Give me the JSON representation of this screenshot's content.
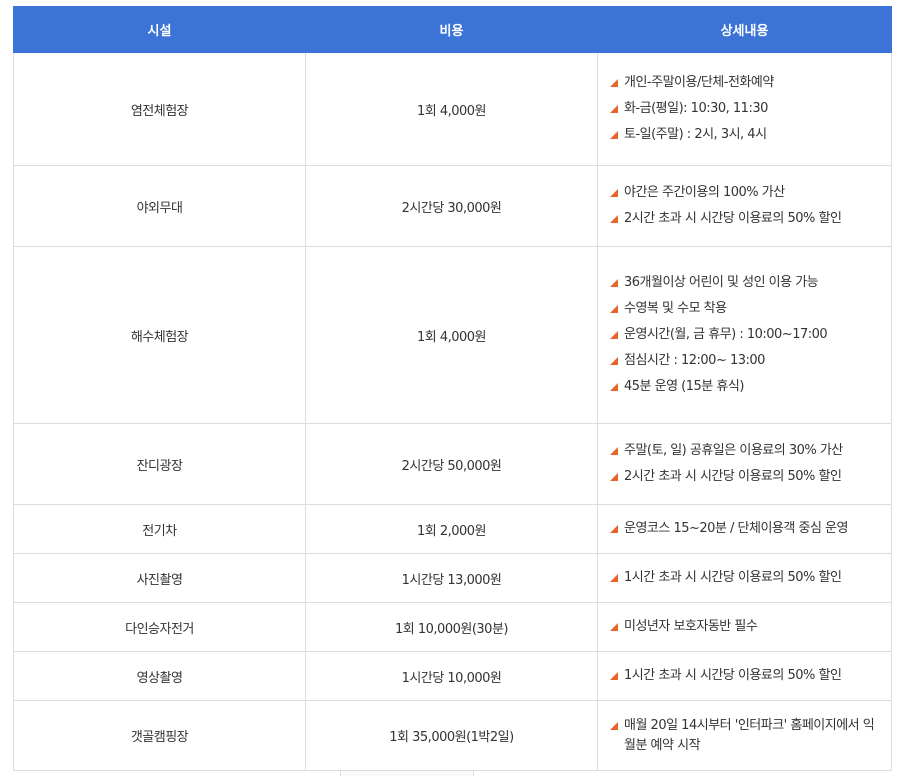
{
  "headers": [
    "시설",
    "비용",
    "상세내용"
  ],
  "rows": [
    {
      "facility": "염전체험장",
      "cost": "1회 4,000원",
      "details": [
        "개인-주말이용/단체-전화예약",
        "화-금(평일): 10:30, 11:30",
        "토-일(주말) : 2시, 3시, 4시"
      ]
    },
    {
      "facility": "야외무대",
      "cost": "2시간당 30,000원",
      "details": [
        "야간은 주간이용의 100% 가산",
        "2시간 초과 시 시간당 이용료의 50% 할인"
      ]
    },
    {
      "facility": "해수체험장",
      "cost": "1회 4,000원",
      "details": [
        "36개월이상 어린이 및 성인 이용 가능",
        "수영복 및 수모 착용",
        "운영시간(월, 금 휴무) : 10:00~17:00",
        "점심시간 : 12:00~ 13:00",
        "45분 운영 (15분 휴식)"
      ]
    },
    {
      "facility": "잔디광장",
      "cost": "2시간당 50,000원",
      "details": [
        "주말(토, 일) 공휴일은 이용료의 30% 가산",
        "2시간 초과 시 시간당 이용료의 50% 할인"
      ]
    },
    {
      "facility": "전기차",
      "cost": "1회 2,000원",
      "details": [
        "운영코스 15~20분 / 단체이용객 중심 운영"
      ]
    },
    {
      "facility": "사진촬영",
      "cost": "1시간당 13,000원",
      "details": [
        "1시간 초과 시 시간당 이용료의 50% 할인"
      ]
    },
    {
      "facility": "다인승자전거",
      "cost": "1회 10,000원(30분)",
      "details": [
        "미성년자 보호자동반 필수"
      ]
    },
    {
      "facility": "영상촬영",
      "cost": "1시간당 10,000원",
      "details": [
        "1시간 초과 시 시간당 이용료의 50% 할인"
      ]
    },
    {
      "facility": "갯골캠핑장",
      "cost": "1회 35,000원(1박2일)",
      "details": [
        "매월 20일 14시부터 '인터파크' 홈페이지에서 익월분 예약 시작"
      ]
    }
  ],
  "colors": {
    "header_bg": "#3b73d6",
    "bullet": "#e8622a",
    "border": "#dddddd"
  }
}
